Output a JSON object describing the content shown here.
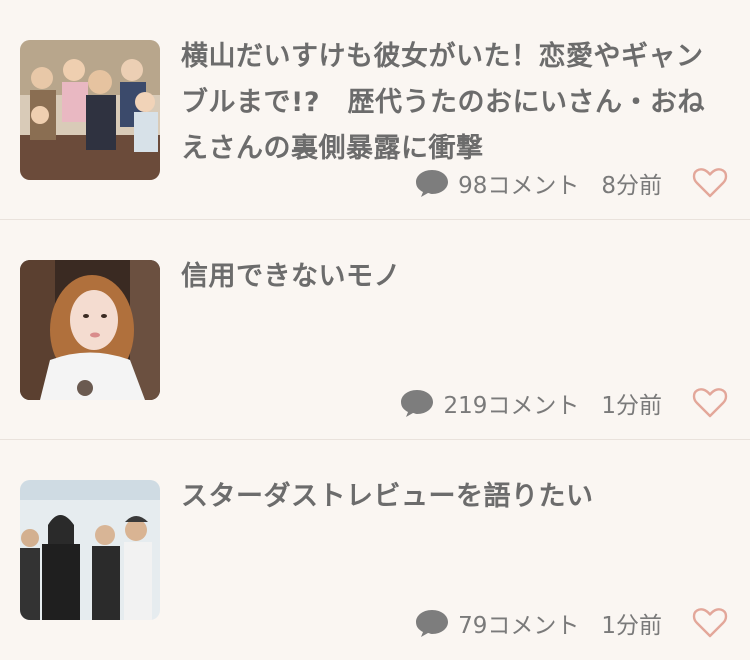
{
  "feed": {
    "items": [
      {
        "title": "横山だいすけも彼女がいた！恋愛やギャンブルまで!?　歴代うたのおにいさん・おねえさんの裏側暴露に衝撃",
        "comments": "98コメント",
        "time": "8分前",
        "thumb_icon": "tv-panel-group-photo"
      },
      {
        "title": "信用できないモノ",
        "comments": "219コメント",
        "time": "1分前",
        "thumb_icon": "woman-portrait-photo"
      },
      {
        "title": "スターダストレビューを語りたい",
        "comments": "79コメント",
        "time": "1分前",
        "thumb_icon": "band-group-photo"
      }
    ],
    "icons": {
      "comment": "speech-bubble-icon",
      "favorite": "heart-outline-icon"
    },
    "colors": {
      "background": "#faf6f2",
      "title": "#6c6c6c",
      "meta": "#7a7a7a",
      "heart": "#e3a79a",
      "divider": "#e9e2dc"
    }
  }
}
